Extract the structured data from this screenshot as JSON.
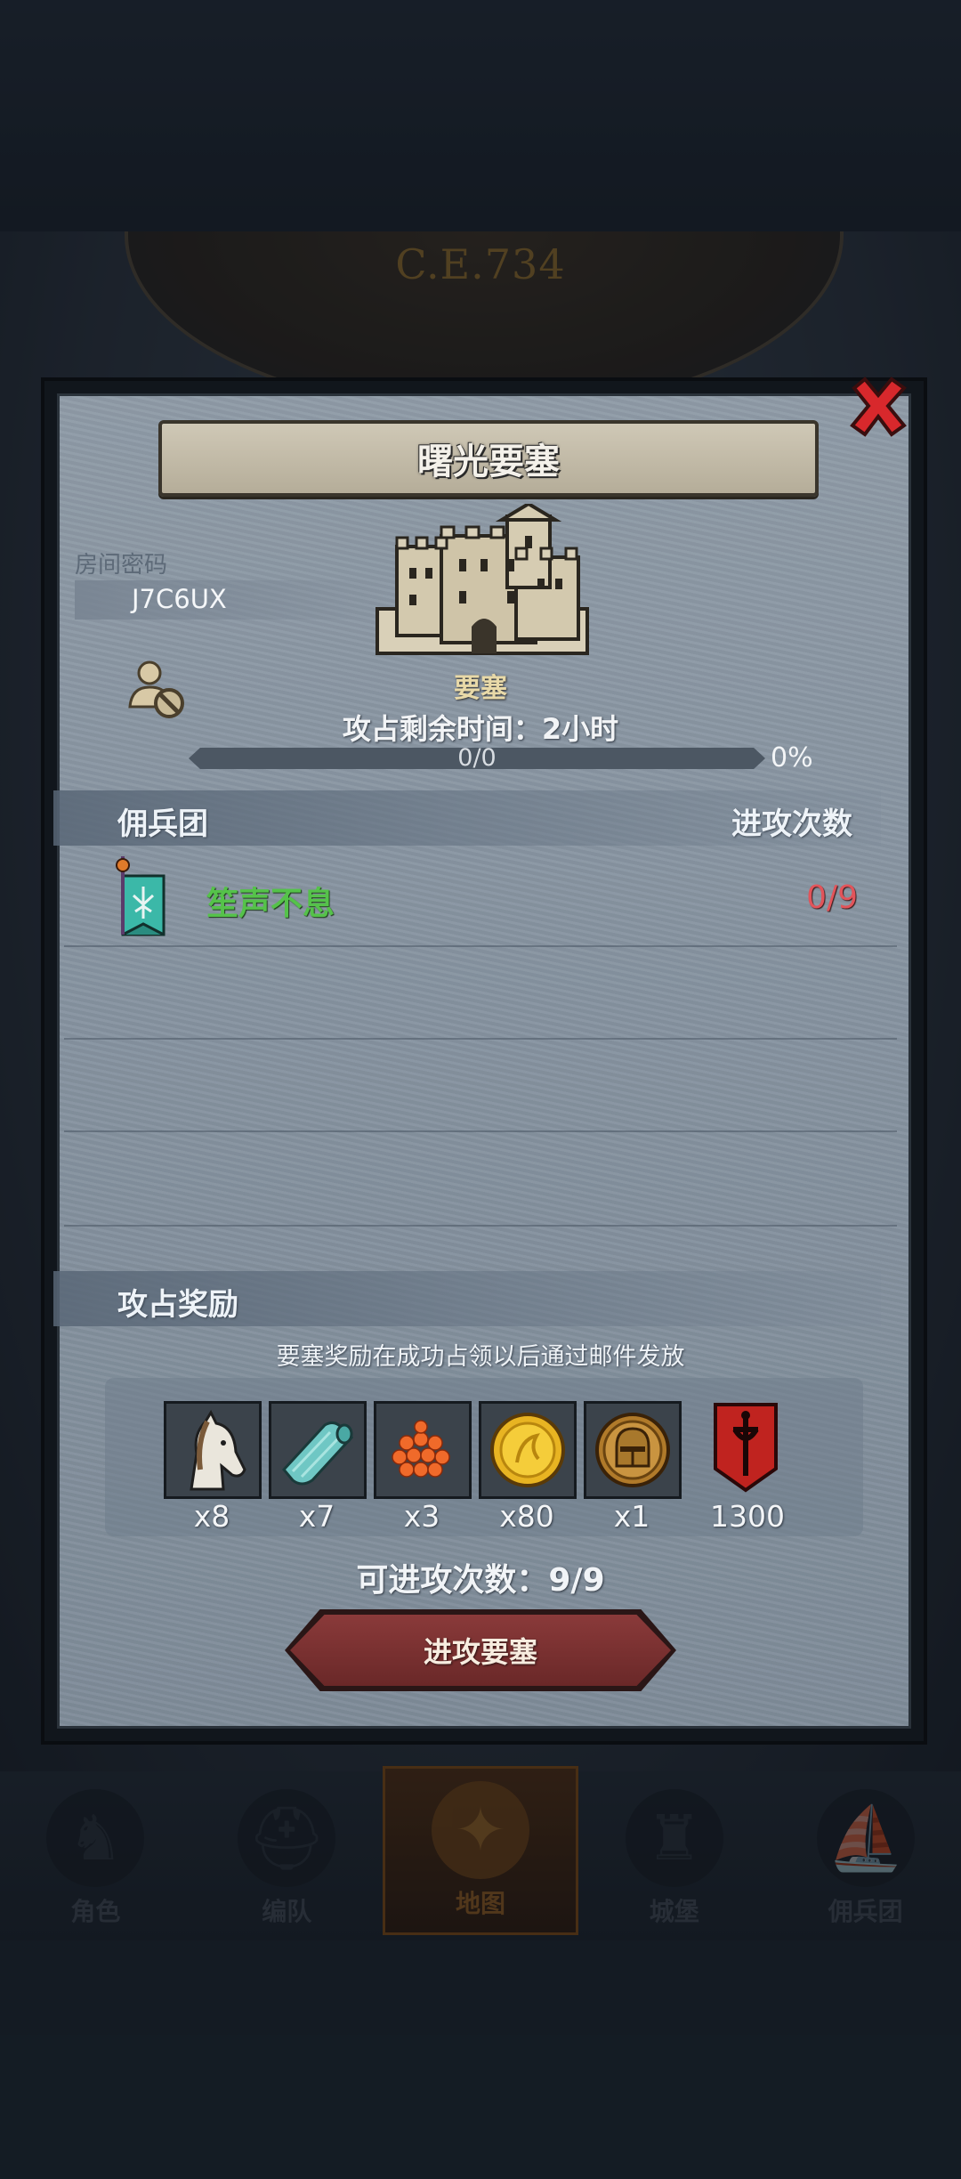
{
  "era": "C.E.734",
  "dialog": {
    "title": "曙光要塞",
    "room_label": "房间密码",
    "room_code": "J7C6UX",
    "privacy_icon": "no-visitors-icon",
    "fortress_name": "要塞",
    "time_left": "攻占剩余时间：2小时",
    "progress_text": "0/0",
    "progress_percent_text": "0%",
    "progress_value": 0,
    "mercenary_section": {
      "title": "佣兵团",
      "right_header": "进攻次数",
      "rows": [
        {
          "name": "笙声不息",
          "count": "0/9",
          "icon": "guild-banner-icon"
        }
      ]
    },
    "reward_section": {
      "title": "攻占奖励",
      "note": "要塞奖励在成功占领以后通过邮件发放",
      "items": [
        {
          "icon": "horse-icon",
          "qty": "x8"
        },
        {
          "icon": "cloth-icon",
          "qty": "x7"
        },
        {
          "icon": "roe-icon",
          "qty": "x3"
        },
        {
          "icon": "gold-coin-icon",
          "qty": "x80"
        },
        {
          "icon": "knight-helmet-coin-icon",
          "qty": "x1"
        },
        {
          "icon": "red-emblem-icon",
          "qty": "1300"
        }
      ]
    },
    "attacks_left": "可进攻次数：9/9",
    "attack_button": "进攻要塞"
  },
  "nav": [
    {
      "label": "角色",
      "icon": "knight-icon",
      "active": false
    },
    {
      "label": "编队",
      "icon": "helmet-icon",
      "active": false
    },
    {
      "label": "地图",
      "icon": "compass-map-icon",
      "active": true
    },
    {
      "label": "城堡",
      "icon": "castle-icon",
      "active": false
    },
    {
      "label": "佣兵团",
      "icon": "ship-icon",
      "active": false
    }
  ],
  "colors": {
    "accent_red": "#e2545a",
    "guild_green": "#55c24a",
    "button_red": "#7a3030"
  }
}
